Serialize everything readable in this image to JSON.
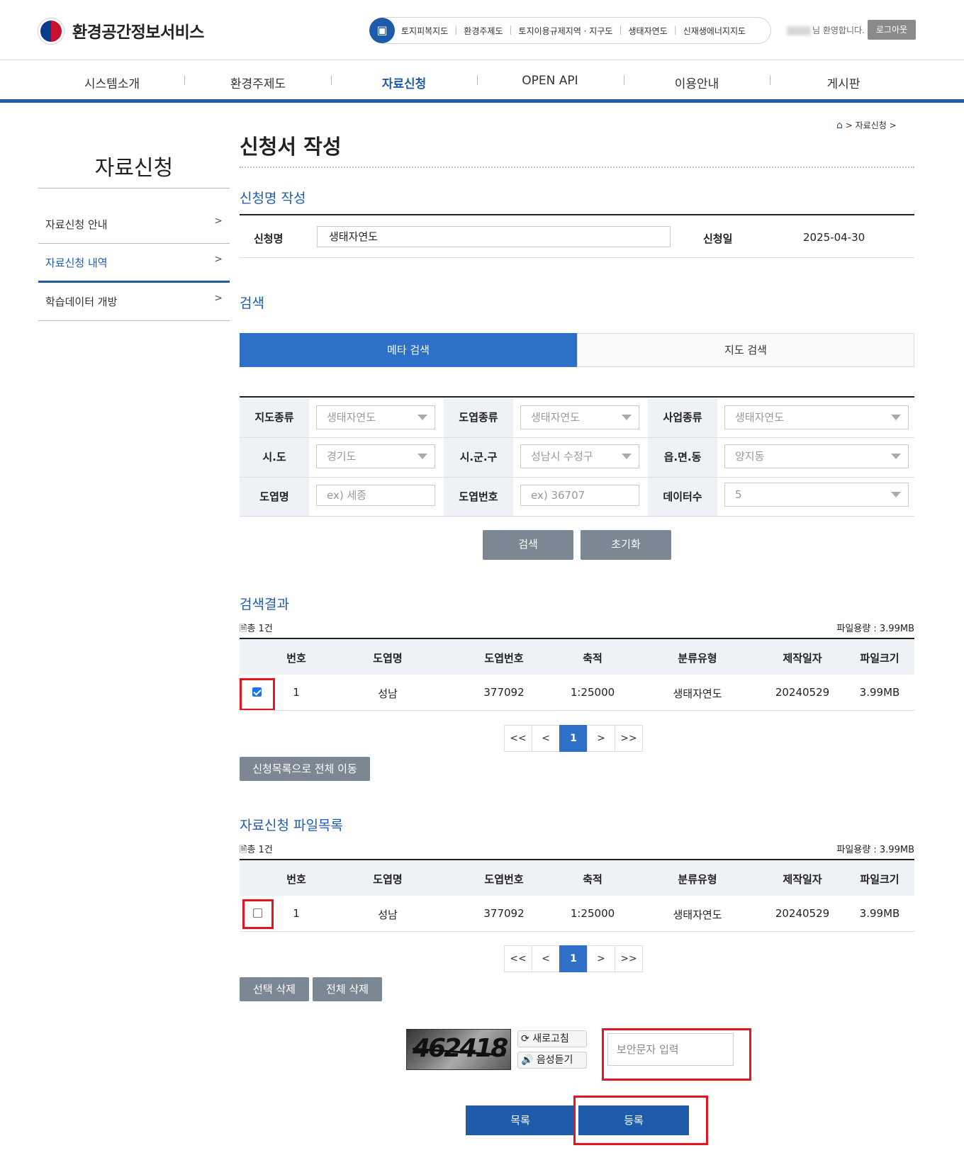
{
  "header": {
    "logo_text": "환경공간정보서비스",
    "quick_links": [
      "토지피복지도",
      "환경주제도",
      "토지이용규제지역 · 지구도",
      "생태자연도",
      "신재생에너지지도"
    ],
    "welcome": "님 환영합니다.",
    "logout": "로그아웃"
  },
  "gnb": [
    "시스템소개",
    "환경주제도",
    "자료신청",
    "OPEN API",
    "이용안내",
    "게시판"
  ],
  "lnb": {
    "title": "자료신청",
    "items": [
      "자료신청 안내",
      "자료신청 내역",
      "학습데이터 개방"
    ],
    "arrow": ">"
  },
  "breadcrumb": {
    "sep": ">",
    "current": "자료신청"
  },
  "page_title": "신청서 작성",
  "app_section": {
    "title": "신청명 작성",
    "name_label": "신청명",
    "name_value": "생태자연도",
    "date_label": "신청일",
    "date_value": "2025-04-30"
  },
  "search": {
    "title": "검색",
    "tab_meta": "메타 검색",
    "tab_map": "지도 검색",
    "labels": [
      "지도종류",
      "도엽종류",
      "사업종류",
      "시.도",
      "시.군.구",
      "읍.면.동",
      "도엽명",
      "도엽번호",
      "데이터수"
    ],
    "fields": [
      "생태자연도",
      "생태자연도",
      "생태자연도",
      "경기도",
      "성남시 수정구",
      "양지동",
      "ex) 세종",
      "ex) 36707",
      "5"
    ],
    "btn_search": "검색",
    "btn_reset": "초기화"
  },
  "results": {
    "title": "검색결과",
    "count": "총 1건",
    "file_size": "파일용량 : 3.99MB",
    "headers": [
      "번호",
      "도엽명",
      "도엽번호",
      "축적",
      "분류유형",
      "제작일자",
      "파일크기"
    ],
    "row": [
      "1",
      "성남",
      "377092",
      "1:25000",
      "생태자연도",
      "20240529",
      "3.99MB"
    ],
    "checked": true,
    "move_all": "신청목록으로 전체 이동"
  },
  "files": {
    "title": "자료신청 파일목록",
    "count": "총 1건",
    "file_size": "파일용량 : 3.99MB",
    "headers": [
      "번호",
      "도엽명",
      "도엽번호",
      "축적",
      "분류유형",
      "제작일자",
      "파일크기"
    ],
    "row": [
      "1",
      "성남",
      "377092",
      "1:25000",
      "생태자연도",
      "20240529",
      "3.99MB"
    ],
    "checked": false,
    "delete_selected": "선택 삭제",
    "delete_all": "전체 삭제"
  },
  "pager": {
    "first": "<<",
    "prev": "<",
    "page": "1",
    "next": ">",
    "last": ">>"
  },
  "captcha": {
    "code": "462418",
    "refresh": "새로고침",
    "audio": "음성듣기",
    "placeholder": "보안문자 입력"
  },
  "actions": {
    "list": "목록",
    "submit": "등록"
  }
}
